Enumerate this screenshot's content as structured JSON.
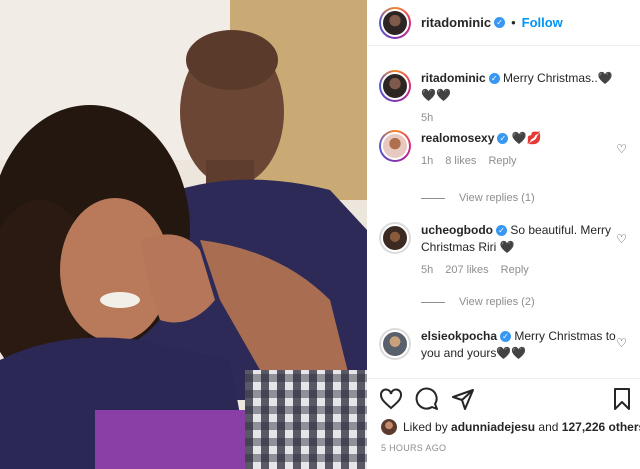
{
  "post": {
    "author": "ritadominic",
    "follow_label": "Follow",
    "separator": "•"
  },
  "caption": {
    "username": "ritadominic",
    "text": "Merry Christmas..🖤🖤🖤",
    "age": "5h"
  },
  "comments": [
    {
      "username": "realomosexy",
      "text": "🖤💋",
      "age": "1h",
      "likes": "8 likes",
      "reply_label": "Reply",
      "view_replies": "View replies (1)"
    },
    {
      "username": "ucheogbodo",
      "text": "So beautiful. Merry Christmas Riri 🖤",
      "age": "5h",
      "likes": "207 likes",
      "reply_label": "Reply",
      "view_replies": "View replies (2)"
    },
    {
      "username": "elsieokpocha",
      "text": "Merry Christmas to you and yours🖤🖤"
    }
  ],
  "likes_line": {
    "prefix": "Liked by",
    "user": "adunniadejesu",
    "middle": "and",
    "count": "127,226 others"
  },
  "timestamp": "5 HOURS AGO",
  "icons": [
    "heart-icon",
    "comment-icon",
    "share-icon",
    "bookmark-icon",
    "verified-badge-icon"
  ],
  "colors": {
    "link": "#0095f6",
    "verified": "#3897f0",
    "muted": "#8e8e8e"
  }
}
